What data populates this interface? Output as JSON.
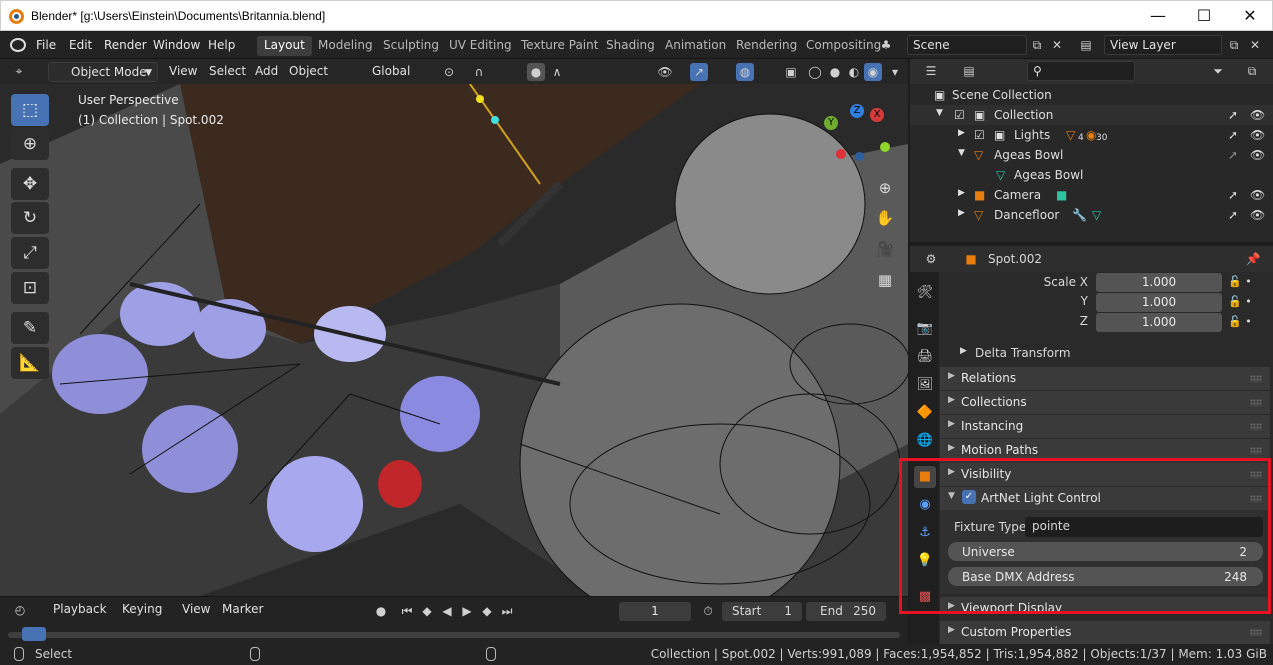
{
  "window": {
    "title": "Blender* [g:\\Users\\Einstein\\Documents\\Britannia.blend]",
    "min": "—",
    "max": "☐",
    "close": "✕"
  },
  "menus": [
    "File",
    "Edit",
    "Render",
    "Window",
    "Help"
  ],
  "workspaces": [
    "Layout",
    "Modeling",
    "Sculpting",
    "UV Editing",
    "Texture Paint",
    "Shading",
    "Animation",
    "Rendering",
    "Compositing"
  ],
  "scene": {
    "label": "Scene",
    "view_layer": "View Layer"
  },
  "viewport": {
    "mode": "Object Mode",
    "menus": [
      "View",
      "Select",
      "Add",
      "Object"
    ],
    "orientation": "Global",
    "perspective": "User Perspective",
    "collection_info": "(1) Collection | Spot.002",
    "gizmo": {
      "x": "X",
      "y": "Y",
      "z": "Z"
    }
  },
  "outliner": {
    "rows": [
      {
        "label": "Scene Collection"
      },
      {
        "label": "Collection"
      },
      {
        "label": "Lights",
        "count_a": "4",
        "count_b": "30"
      },
      {
        "label": "Ageas Bowl"
      },
      {
        "label": "Ageas Bowl"
      },
      {
        "label": "Camera"
      },
      {
        "label": "Dancefloor"
      }
    ]
  },
  "properties": {
    "object_name": "Spot.002",
    "scale": [
      {
        "axis": "Scale X",
        "value": "1.000"
      },
      {
        "axis": "Y",
        "value": "1.000"
      },
      {
        "axis": "Z",
        "value": "1.000"
      }
    ],
    "delta": "Delta Transform",
    "sections": [
      "Relations",
      "Collections",
      "Instancing",
      "Motion Paths",
      "Visibility"
    ],
    "artnet": {
      "title": "ArtNet Light Control",
      "fixture_label": "Fixture Type:",
      "fixture_value": "pointe",
      "universe_label": "Universe",
      "universe_value": "2",
      "dmx_label": "Base DMX Address",
      "dmx_value": "248"
    },
    "viewport_display": "Viewport Display",
    "custom_props": "Custom Properties"
  },
  "timeline": {
    "playback": "Playback",
    "keying": "Keying",
    "view": "View",
    "marker": "Marker",
    "frame": "1",
    "start_label": "Start",
    "start": "1",
    "end_label": "End",
    "end": "250"
  },
  "status": {
    "select": "Select",
    "info": "Collection | Spot.002 | Verts:991,089 | Faces:1,954,852 | Tris:1,954,882 | Objects:1/37 | Mem: 1.03 GiB"
  },
  "colors": {
    "accent": "#4772b3",
    "highlight": "#e81123",
    "orange": "#e87d0d"
  }
}
